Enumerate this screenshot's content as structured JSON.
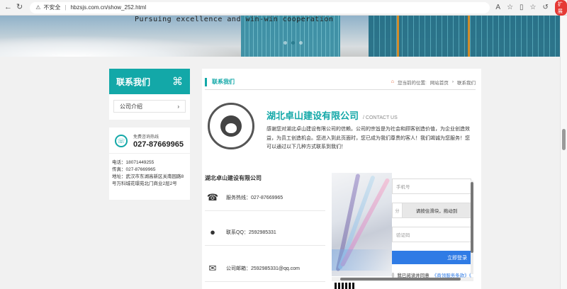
{
  "browser": {
    "security_label": "不安全",
    "url": "hbzsjs.com.cn/show_252.html",
    "back_icon": "back-arrow-icon",
    "extension_label": "扩展"
  },
  "banner": {
    "tagline": "Pursuing excellence and win-win cooperation"
  },
  "sidebar": {
    "title": "联系我们",
    "menu_item": "公司介绍",
    "hotline_label": "免费咨询热线",
    "hotline_number": "027-87669965",
    "phone": "电话：18071449255",
    "fax": "传真：027-87669965",
    "address": "地址：武汉市东湖高新区关南园路8号万科城花璟苑北门商业2层2号"
  },
  "main": {
    "section_title": "联系我们",
    "breadcrumb_prefix": "您当前的位置:",
    "breadcrumb_home": "网站首页",
    "breadcrumb_current": "联系我们",
    "company_name": "湖北卓山建设有限公司",
    "company_suffix": "/ CONTACT US",
    "intro": "感谢您对湖北卓山建设有限公司的信赖。公司的宗旨是为社会和顾客创造价值，为企业创造效益，为员工创造机会。您进入到此页面时，您已成为我们尊贵的客人！我们竭诚为您服务！您可以通过以下几种方式联系到我们！",
    "info_title": "湖北卓山建设有限公司",
    "service_hotline": "服务热线：027-87669965",
    "qq": "联系QQ：2592985331",
    "email": "公司邮箱：2592985331@qq.com"
  },
  "form": {
    "phone_placeholder": "手机号",
    "slider_knob": "分",
    "slider_text": "请按住滑块，拖动到",
    "code_placeholder": "验证码",
    "submit_label": "立即登录",
    "agree_prefix": "我已阅读并同意",
    "agree_link": "《商领服务条款》《"
  },
  "colors": {
    "accent": "#13a8a8",
    "button": "#2f7be5"
  }
}
